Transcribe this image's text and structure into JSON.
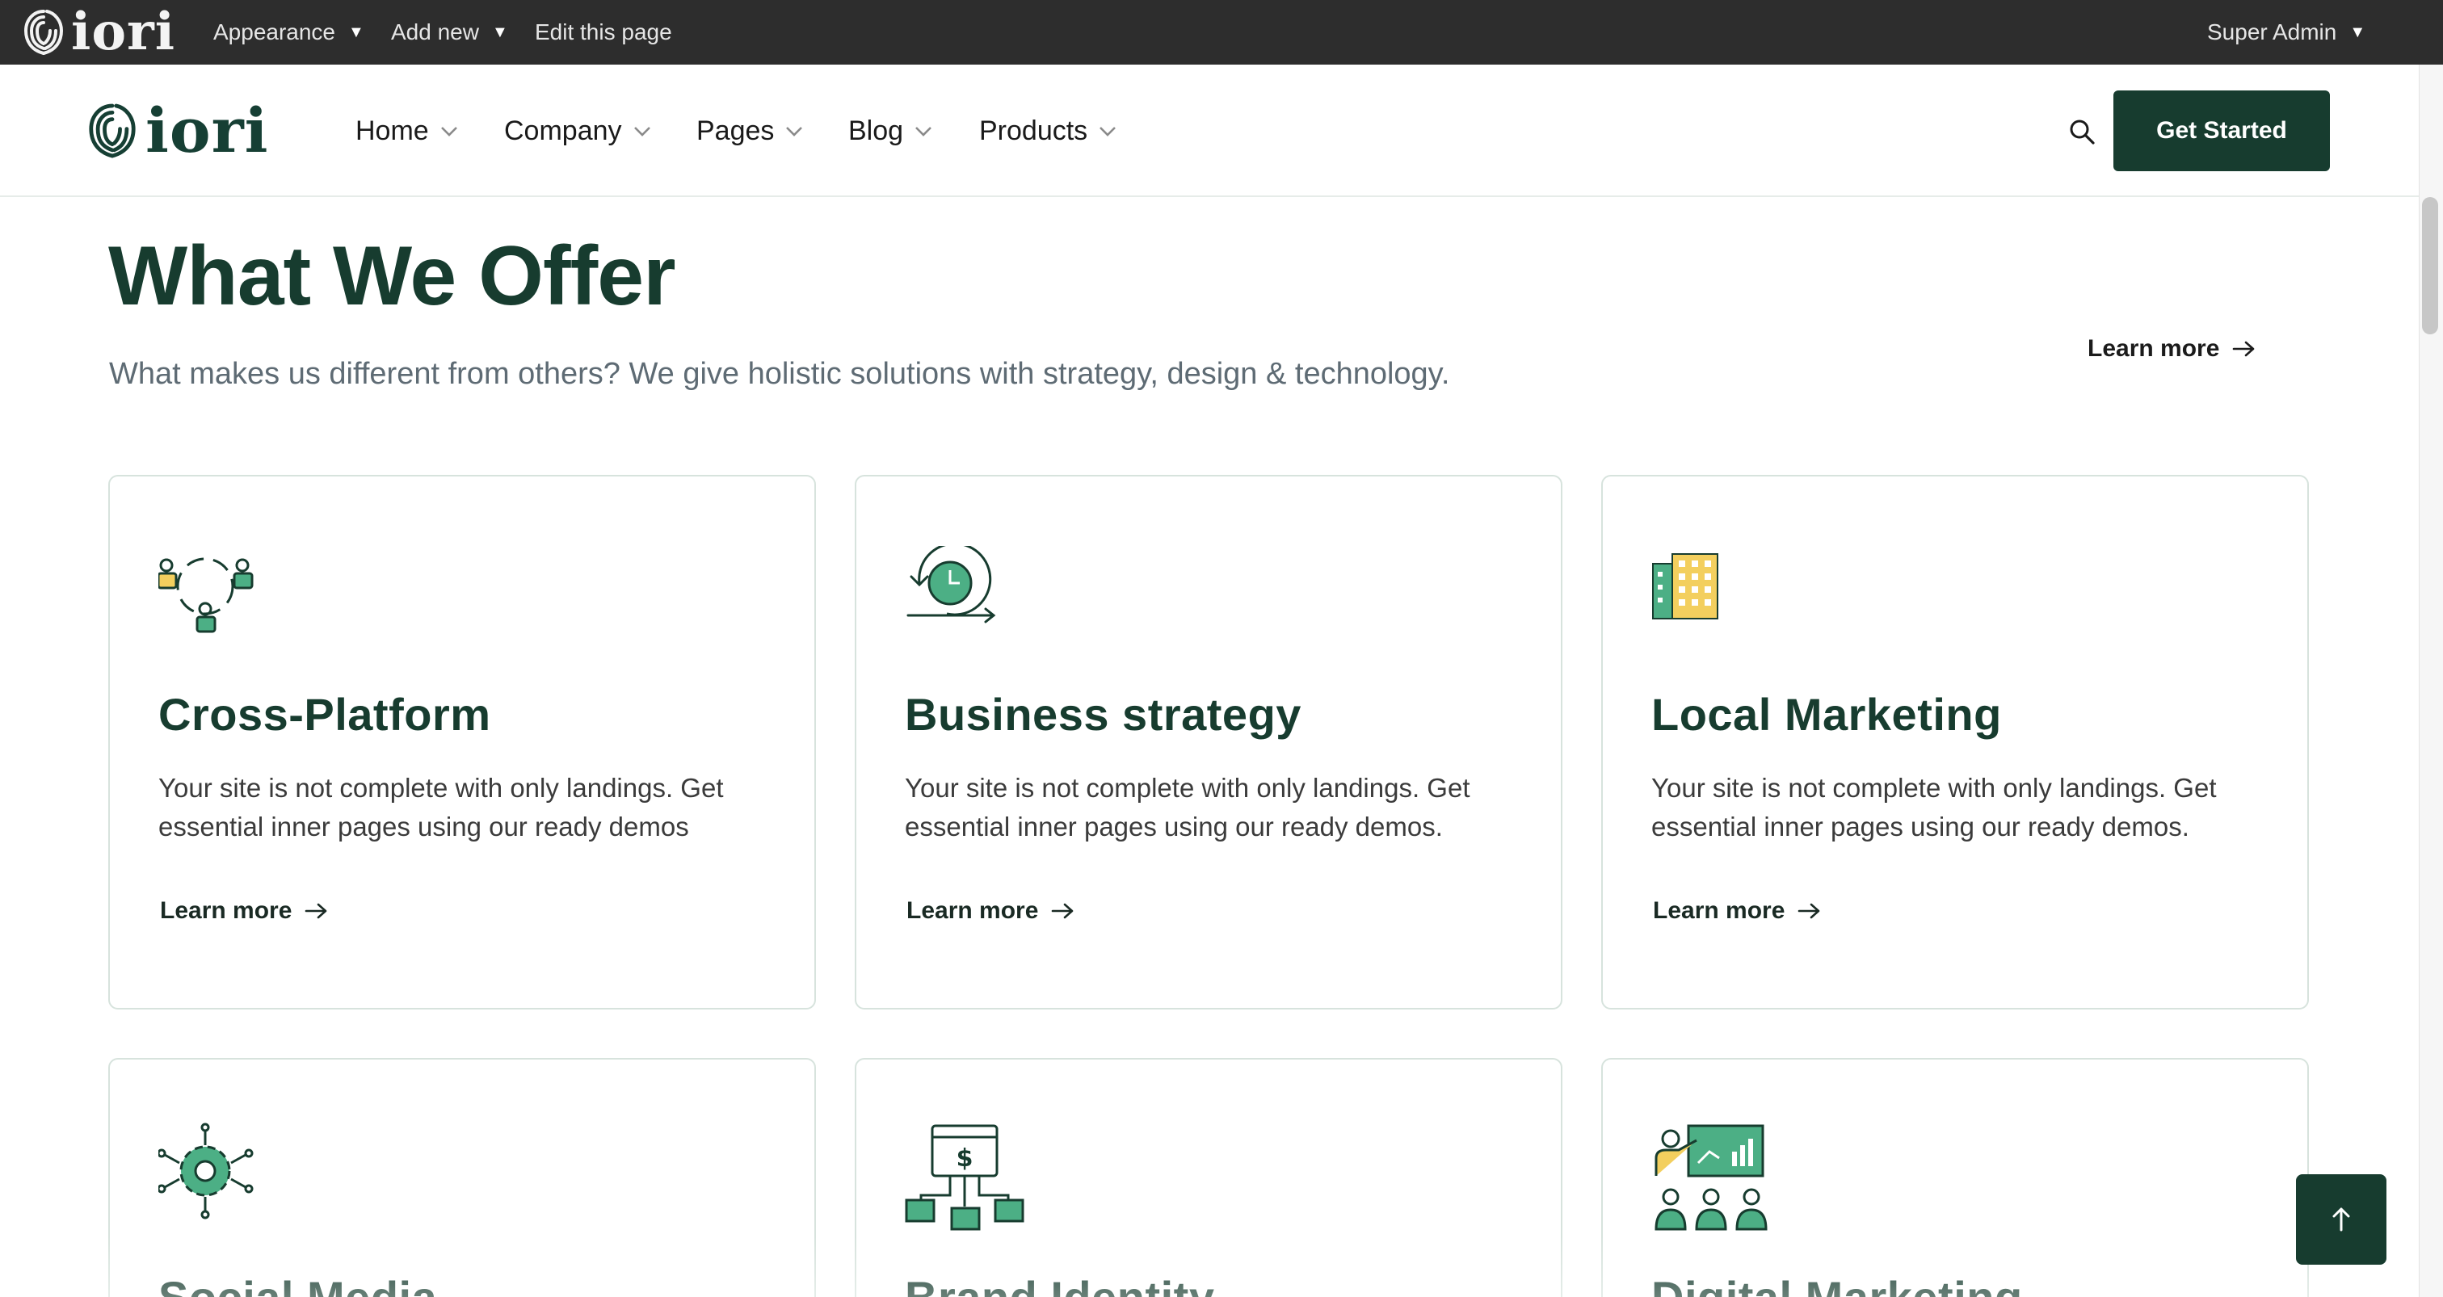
{
  "admin_bar": {
    "logo_text": "iori",
    "menu": [
      {
        "label": "Appearance"
      },
      {
        "label": "Add new"
      },
      {
        "label": "Edit this page"
      }
    ],
    "user_label": "Super Admin"
  },
  "header": {
    "logo_text": "iori",
    "nav": [
      {
        "label": "Home"
      },
      {
        "label": "Company"
      },
      {
        "label": "Pages"
      },
      {
        "label": "Blog"
      },
      {
        "label": "Products"
      }
    ],
    "cta_label": "Get Started"
  },
  "section": {
    "title": "What We Offer",
    "subtitle": "What makes us different from others? We give holistic solutions with strategy, design & technology.",
    "link_label": "Learn more"
  },
  "cards": [
    {
      "title": "Cross-Platform",
      "desc": "Your site is not complete with only landings. Get essential inner pages using our ready demos",
      "link": "Learn more",
      "icon": "people-network-icon"
    },
    {
      "title": "Business strategy",
      "desc": "Your site is not complete with only landings. Get essential inner pages using our ready demos.",
      "link": "Learn more",
      "icon": "clock-cycle-icon"
    },
    {
      "title": "Local Marketing",
      "desc": "Your site is not complete with only landings. Get essential inner pages using our ready demos.",
      "link": "Learn more",
      "icon": "buildings-icon"
    },
    {
      "title": "Social Media",
      "icon": "gear-network-icon"
    },
    {
      "title": "Brand Identity",
      "icon": "money-flow-icon"
    },
    {
      "title": "Digital Marketing",
      "icon": "presentation-icon"
    }
  ],
  "colors": {
    "brand": "#173c2f",
    "accent_green": "#4caf85",
    "accent_yellow": "#f3cf5e",
    "admin_bar": "#2d2d2d"
  }
}
